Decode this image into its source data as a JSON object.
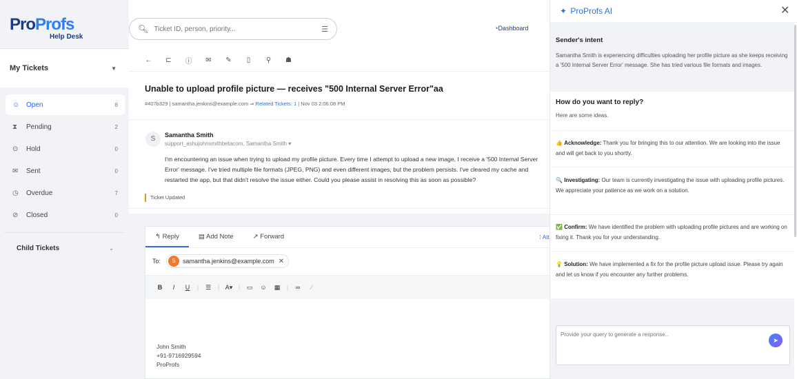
{
  "logo": {
    "pro_a": "Pro",
    "pro_b": "Profs",
    "sub": "Help Desk"
  },
  "sidebar": {
    "dropdown": "My Tickets",
    "items": [
      {
        "label": "Open",
        "count": "8",
        "icon": "chat-icon",
        "glyph": "☺"
      },
      {
        "label": "Pending",
        "count": "2",
        "icon": "hourglass-icon",
        "glyph": "⧗"
      },
      {
        "label": "Hold",
        "count": "0",
        "icon": "pause-icon",
        "glyph": "⊙"
      },
      {
        "label": "Sent",
        "count": "0",
        "icon": "mail-icon",
        "glyph": "✉"
      },
      {
        "label": "Overdue",
        "count": "7",
        "icon": "clock-icon",
        "glyph": "◷"
      },
      {
        "label": "Closed",
        "count": "0",
        "icon": "check-circle-icon",
        "glyph": "⊘"
      }
    ],
    "child_tickets": "Child Tickets"
  },
  "search": {
    "placeholder": "Ticket ID, person, priority..."
  },
  "header": {
    "dashboard": "Dashboard"
  },
  "ticket": {
    "title": "Unable to upload profile picture — receives \"500 Internal Server Error\"aa",
    "meta_prefix": "#407b329 | samantha.jenkins@example.com ⇒ ",
    "meta_related": "Related Tickets: 1",
    "meta_suffix": " | Nov 03 2:06:08 PM",
    "sender": "Samantha Smith",
    "avatar_initial": "S",
    "sender_email": "support_ashujohnsmithbetacom, Samantha Smith ▾",
    "message": "I'm encountering an issue when trying to upload my profile picture. Every time I attempt to upload a new image, I receive a '500 Internal Server Error' message. I've tried multiple file formats (JPEG, PNG) and even different images, but the problem persists. I've cleared my cache and restarted the app, but that didn't resolve the issue either. Could you please assist in resolving this as soon as possible?",
    "updated": "Ticket Updated"
  },
  "compose": {
    "tabs": [
      "Reply",
      "Add Note",
      "Forward"
    ],
    "attach": "Att",
    "to_label": "To:",
    "to_initial": "S",
    "to_email": "samantha.jenkins@example.com",
    "signature": [
      "John Smith",
      "+91-9716929594",
      "ProProfs"
    ]
  },
  "ai": {
    "title": "ProProfs AI",
    "intent_title": "Sender's intent",
    "intent_text": "Samantha Smith is experiencing difficulties uploading her profile picture as she keeps receiving a '500 Internal Server Error' message. She has tried various file formats and images.",
    "how_title": "How do you want to reply?",
    "how_sub": "Here are some ideas.",
    "ideas": [
      {
        "emoji": "👍",
        "key": "Acknowledge:",
        "text": "Thank you for bringing this to our attention. We are looking into the issue and will get back to you shortly."
      },
      {
        "emoji": "🔍",
        "key": "Investigating:",
        "text": "Our team is currently investigating the issue with uploading profile pictures. We appreciate your patience as we work on a solution."
      },
      {
        "emoji": "✅",
        "key": "Confirm:",
        "text": "We have identified the problem with uploading profile pictures and are working on fixing it. Thank you for your understanding."
      },
      {
        "emoji": "💡",
        "key": "Solution:",
        "text": "We have implemented a fix for the profile picture upload issue. Please try again and let us know if you encounter any further problems."
      }
    ],
    "query_placeholder": "Provide your query to generate a response..",
    "accent": "#2f6fd8"
  }
}
